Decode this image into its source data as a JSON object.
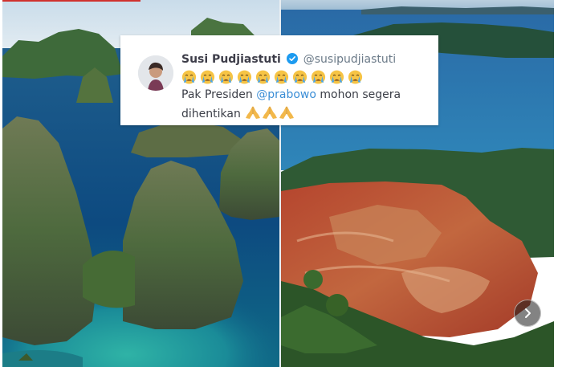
{
  "tweet": {
    "author_name": "Susi Pudjiastuti",
    "author_handle": "@susipudjiastuti",
    "emoji_row": [
      "crying-face-emoji",
      "crying-face-emoji",
      "crying-face-emoji",
      "crying-face-emoji",
      "crying-face-emoji",
      "crying-face-emoji",
      "crying-face-emoji",
      "crying-face-emoji",
      "crying-face-emoji",
      "crying-face-emoji"
    ],
    "line1_before": "Pak Presiden ",
    "mention": "@prabowo",
    "line1_after": " mohon segera",
    "line2": "dihentikan",
    "trailing_emoji": [
      "folded-hands-emoji",
      "folded-hands-emoji",
      "folded-hands-emoji"
    ]
  },
  "images": {
    "left": "raja-ampat-karst-islands-photo",
    "right": "nickel-mining-site-photo"
  },
  "carousel": {
    "next_icon": "chevron-right-icon"
  },
  "colors": {
    "mention": "#3b8ed6",
    "verified_badge": "#1d9bf0",
    "accent_bar": "#d0312d"
  }
}
